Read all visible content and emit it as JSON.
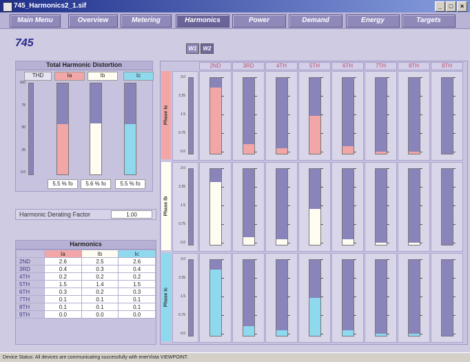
{
  "window": {
    "title": "745_Harmonics2_1.sif"
  },
  "menu": [
    "Main Menu",
    "Overview",
    "Metering",
    "Harmonics",
    "Power",
    "Demand",
    "Energy",
    "Targets"
  ],
  "menu_active": 3,
  "device_label": "745",
  "winding_tabs": [
    "W1",
    "W2"
  ],
  "thd": {
    "title": "Total Harmonic Distortion",
    "col_label": "THD",
    "phases": [
      "Ia",
      "Ib",
      "Ic"
    ],
    "phase_colors": [
      "#f2a6a6",
      "#fffdf2",
      "#8fd9ee"
    ],
    "ticks": [
      "100",
      "75",
      "50",
      "25",
      "0.0"
    ],
    "levels": [
      0.55,
      0.56,
      0.55
    ],
    "values": [
      "5.5 % fo",
      "5.6 % fo",
      "5.5 % fo"
    ]
  },
  "derating": {
    "label": "Harmonic Derating Factor",
    "value": "1.00"
  },
  "harmonics_table": {
    "title": "Harmonics",
    "headers": [
      "Ia",
      "Ib",
      "Ic"
    ],
    "rows": [
      {
        "h": "2ND",
        "v": [
          "2.6",
          "2.5",
          "2.6"
        ]
      },
      {
        "h": "3RD",
        "v": [
          "0.4",
          "0.3",
          "0.4"
        ]
      },
      {
        "h": "4TH",
        "v": [
          "0.2",
          "0.2",
          "0.2"
        ]
      },
      {
        "h": "5TH",
        "v": [
          "1.5",
          "1.4",
          "1.5"
        ]
      },
      {
        "h": "6TH",
        "v": [
          "0.3",
          "0.2",
          "0.3"
        ]
      },
      {
        "h": "7TH",
        "v": [
          "0.1",
          "0.1",
          "0.1"
        ]
      },
      {
        "h": "8TH",
        "v": [
          "0.1",
          "0.1",
          "0.1"
        ]
      },
      {
        "h": "9TH",
        "v": [
          "0.0",
          "0.0",
          "0.0"
        ]
      }
    ]
  },
  "grid": {
    "columns": [
      "2ND",
      "3RD",
      "4TH",
      "5TH",
      "6TH",
      "7TH",
      "8TH",
      "9TH"
    ],
    "phase_labels": [
      "Phase Ia",
      "Phase Ib",
      "Phase Ic"
    ],
    "scale_ticks": [
      "3.0",
      "2.25",
      "1.5",
      "0.75",
      "0.0"
    ],
    "levels": [
      [
        0.87,
        0.13,
        0.07,
        0.5,
        0.1,
        0.03,
        0.03,
        0.0
      ],
      [
        0.83,
        0.1,
        0.07,
        0.47,
        0.07,
        0.03,
        0.03,
        0.0
      ],
      [
        0.87,
        0.13,
        0.07,
        0.5,
        0.07,
        0.03,
        0.03,
        0.0
      ]
    ],
    "colors": [
      "#f2a6a6",
      "#fffdf2",
      "#8fd9ee"
    ]
  },
  "status": {
    "text": "Device Status: All devices are communicating successfully with enerVista VIEWPOINT."
  }
}
